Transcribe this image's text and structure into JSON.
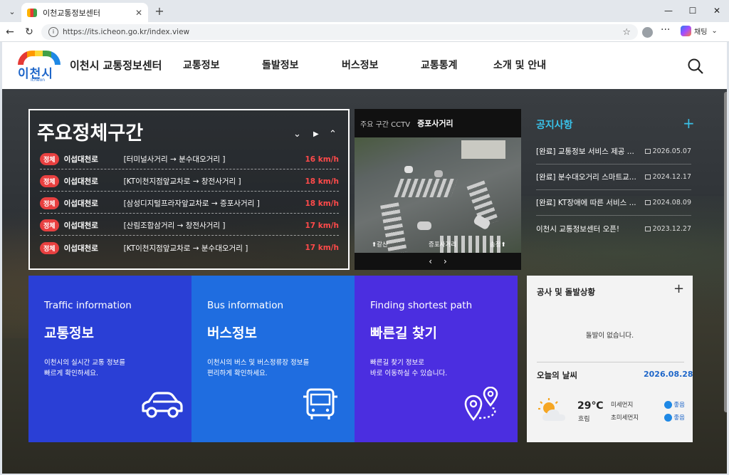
{
  "browser": {
    "tab_title": "이천교통정보센터",
    "url": "https://its.icheon.go.kr/index.view",
    "copilot_label": "채팅"
  },
  "site": {
    "logo_name": "이천시",
    "logo_en": "Icheon",
    "title": "이천시 교통정보센터",
    "menu": [
      "교통정보",
      "돌발정보",
      "버스정보",
      "교통통계",
      "소개 및 안내"
    ]
  },
  "congestion": {
    "title": "주요정체구간",
    "rows": [
      {
        "badge": "정체",
        "road": "이섭대천로",
        "section": "[터미널사거리 → 분수대오거리 ]",
        "speed": "16 km/h"
      },
      {
        "badge": "정체",
        "road": "이섭대천로",
        "section": "[KT이천지점앞교차로 → 창전사거리 ]",
        "speed": "18 km/h"
      },
      {
        "badge": "정체",
        "road": "이섭대천로",
        "section": "[삼성디지털프라자앞교차로 → 증포사거리 ]",
        "speed": "18 km/h"
      },
      {
        "badge": "정체",
        "road": "이섭대천로",
        "section": "[산림조합삼거리 → 창전사거리 ]",
        "speed": "17 km/h"
      },
      {
        "badge": "정체",
        "road": "이섭대천로",
        "section": "[KT이천지점앞교차로 → 분수대오거리 ]",
        "speed": "17 km/h"
      }
    ]
  },
  "cctv": {
    "label": "주요 구간 CCTV",
    "location": "증포사거리",
    "overlay_left": "⬆갈산",
    "overlay_center": "증포사거리",
    "overlay_right": "송정⬆"
  },
  "notice": {
    "title": "공지사항",
    "items": [
      {
        "title": "[완료] 교통정보 서비스 제공 ...",
        "date": "2026.05.07"
      },
      {
        "title": "[완료] 분수대오거리 스마트교...",
        "date": "2024.12.17"
      },
      {
        "title": "[완료] KT장애에 따른 서비스 ...",
        "date": "2024.08.09"
      },
      {
        "title": "이천시 교통정보센터 오픈!",
        "date": "2023.12.27"
      }
    ]
  },
  "cards": [
    {
      "en": "Traffic information",
      "ko": "교통정보",
      "desc1": "이천시의 실시간 교통 정보를",
      "desc2": "빠르게 확인하세요.",
      "color": "#2a3fd6",
      "icon": "car-icon"
    },
    {
      "en": "Bus information",
      "ko": "버스정보",
      "desc1": "이천시의 버스 및 버스정류장 정보를",
      "desc2": "편리하게 확인하세요.",
      "color": "#1f6de0",
      "icon": "bus-icon"
    },
    {
      "en": "Finding shortest path",
      "ko": "빠른길 찾기",
      "desc1": "빠른길 찾기 정보로",
      "desc2": "바로 이동하실 수 있습니다.",
      "color": "#4b2ee0",
      "icon": "route-pin-icon"
    }
  ],
  "incident": {
    "title": "공사 및 돌발상황",
    "message": "돌발이 없습니다."
  },
  "weather": {
    "title": "오늘의 날씨",
    "date": "2026.08.28",
    "temp": "29℃",
    "desc": "흐림",
    "dust_label": "미세먼지",
    "dust_status": "좋음",
    "ultra_label": "초미세먼지",
    "ultra_status": "좋음"
  }
}
